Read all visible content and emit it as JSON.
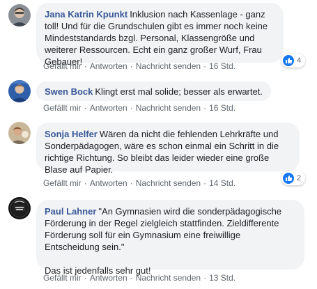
{
  "accent_color": "#385898",
  "bubble_color": "#f2f3f5",
  "comments": [
    {
      "author": "Jana Katrin Kpunkt",
      "text": "Inklusion nach Kassenlage - ganz toll! Und für die Grundschulen gibt es immer noch keine Mindeststandards bzgl. Personal, Klassengröße und weiterer Ressourcen. Echt ein ganz großer Wurf, Frau Gebauer!",
      "reactions": "4",
      "reaction_icon": "like-icon",
      "time": "16 Std."
    },
    {
      "author": "Swen Bock",
      "text": "Klingt erst mal solide; besser als erwartet.",
      "time": "16 Std."
    },
    {
      "author": "Sonja Helfer",
      "text": "Wären da nicht die fehlenden Lehrkräfte und Sonderpädagogen, wäre es schon einmal ein Schritt in die richtige Richtung. So bleibt das leider wieder eine große Blase auf Papier.",
      "reactions": "2",
      "reaction_icon": "like-icon",
      "time": "14 Std."
    },
    {
      "author": "Paul Lahner",
      "text": "\"An Gymnasien wird die sonderpädagogische Förderung in der Regel zielgleich stattfinden. Zieldifferente Förderung soll für ein Gymnasium eine freiwillige Entscheidung sein.\"",
      "text2": "Das ist jedenfalls sehr gut!",
      "time": "13 Std."
    }
  ],
  "actions": {
    "like": "Gefällt mir",
    "reply": "Antworten",
    "message": "Nachricht senden",
    "separator": "·"
  }
}
